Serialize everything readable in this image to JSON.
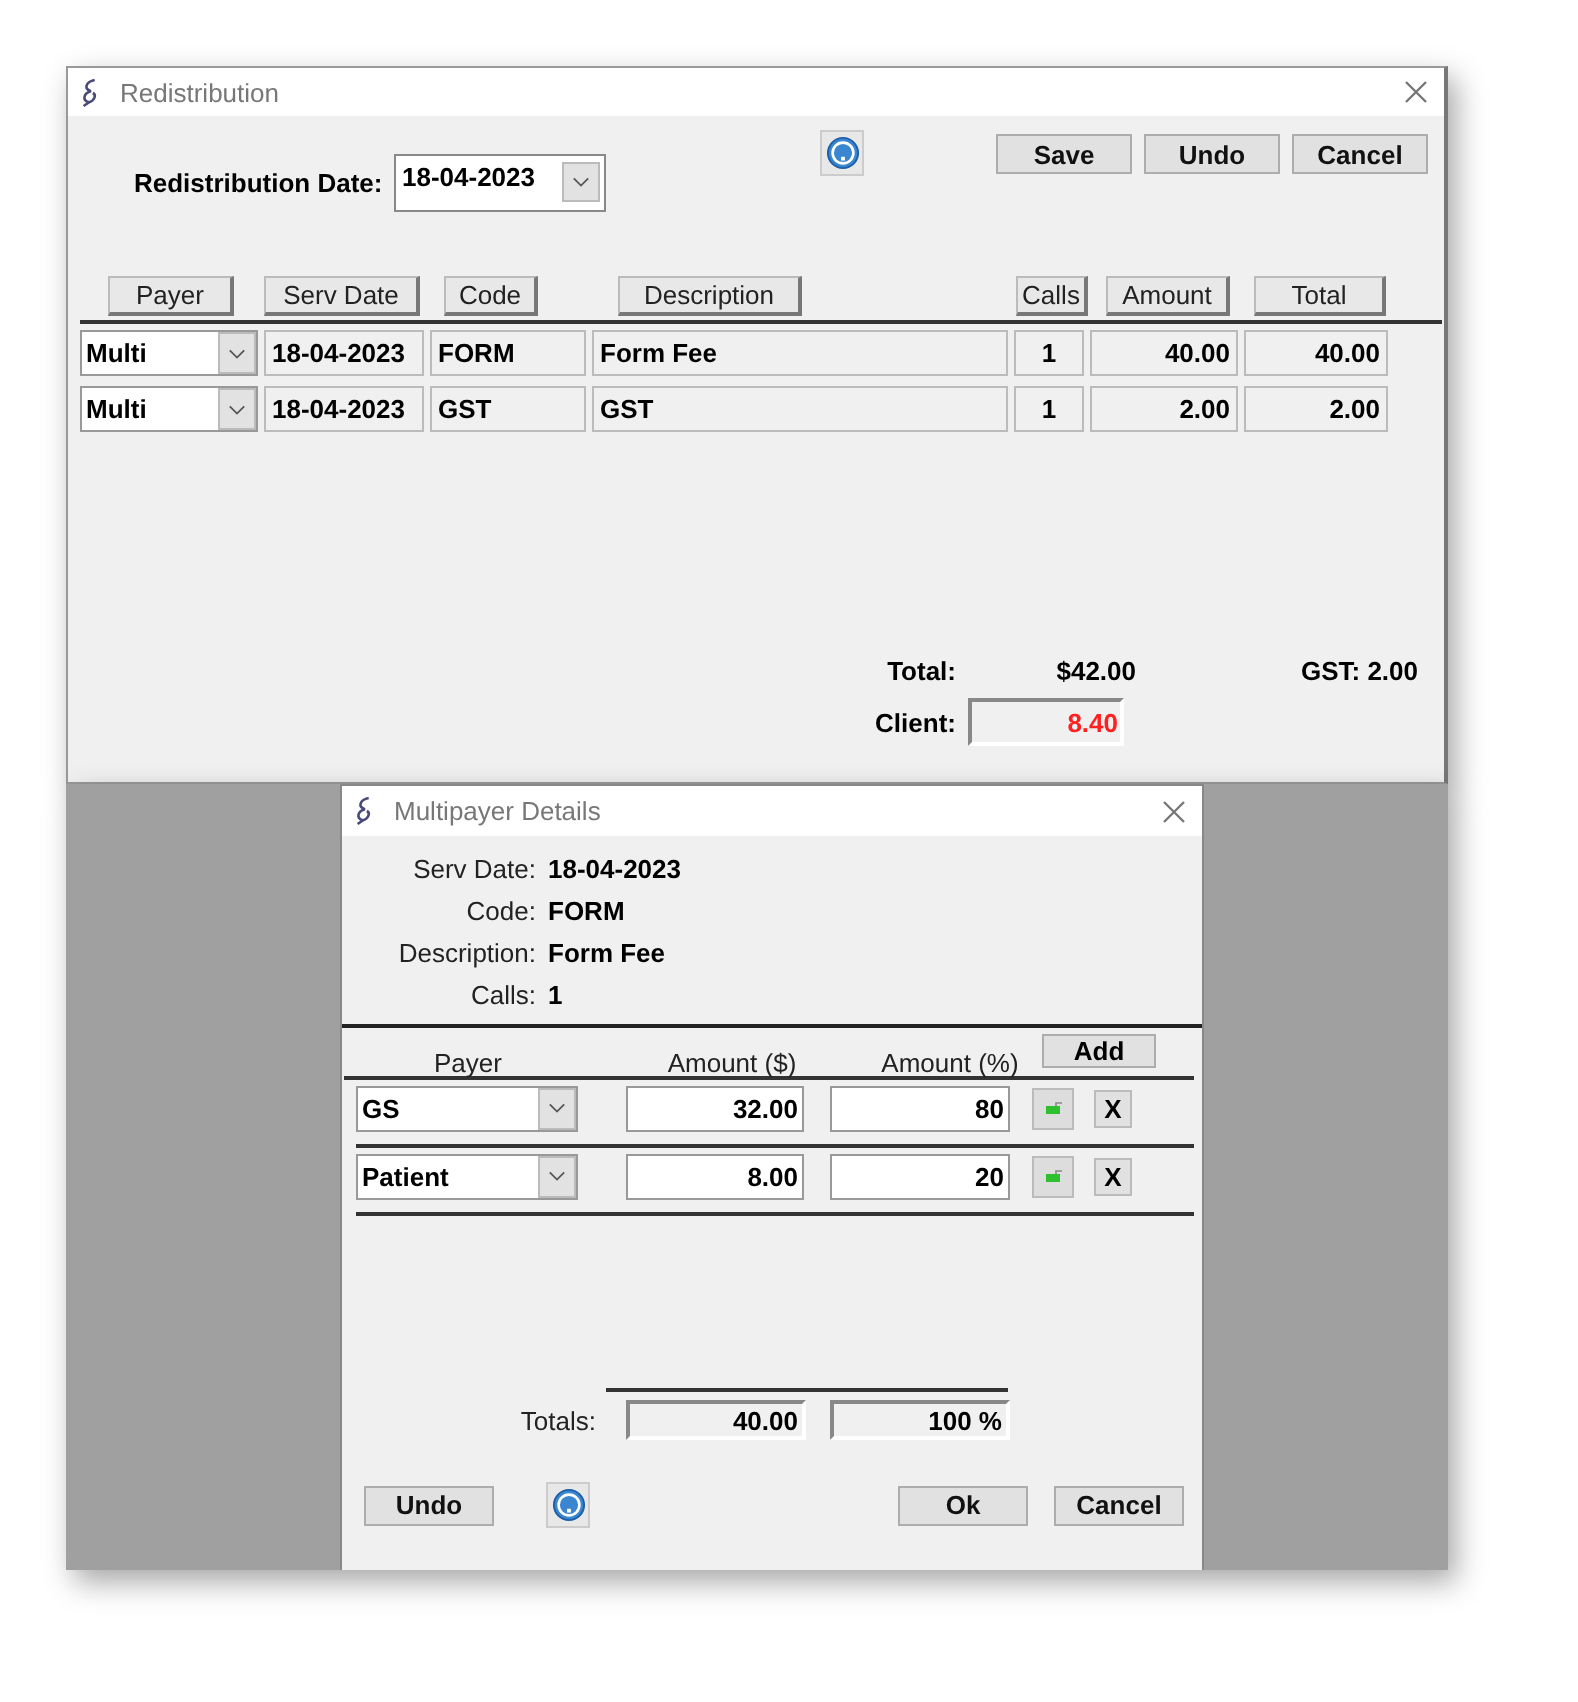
{
  "main_window": {
    "title": "Redistribution",
    "date_label": "Redistribution Date:",
    "date_value": "18-04-2023",
    "buttons": [
      "Save",
      "Undo",
      "Cancel"
    ],
    "columns": [
      "Payer",
      "Serv Date",
      "Code",
      "Description",
      "Calls",
      "Amount",
      "Total"
    ],
    "rows": [
      {
        "payer": "Multi",
        "serv_date": "18-04-2023",
        "code": "FORM",
        "description": "Form Fee",
        "calls": "1",
        "amount": "40.00",
        "total": "40.00"
      },
      {
        "payer": "Multi",
        "serv_date": "18-04-2023",
        "code": "GST",
        "description": "GST",
        "calls": "1",
        "amount": "2.00",
        "total": "2.00"
      }
    ],
    "total_label": "Total:",
    "total_value": "$42.00",
    "gst": "GST: 2.00",
    "client_label": "Client:",
    "client_value": "8.40"
  },
  "dialog": {
    "title": "Multipayer Details",
    "details": [
      {
        "label": "Serv Date:",
        "value": "18-04-2023"
      },
      {
        "label": "Code:",
        "value": "FORM"
      },
      {
        "label": "Description:",
        "value": "Form Fee"
      },
      {
        "label": "Calls:",
        "value": "1"
      }
    ],
    "columns": [
      "Payer",
      "Amount ($)",
      "Amount (%)"
    ],
    "add_button": "Add",
    "payers": [
      {
        "payer": "GS",
        "amount": "32.00",
        "percent": "80",
        "remove": "X"
      },
      {
        "payer": "Patient",
        "amount": "8.00",
        "percent": "20",
        "remove": "X"
      }
    ],
    "totals_label": "Totals:",
    "totals_amount": "40.00",
    "totals_percent": "100 %",
    "undo_button": "Undo",
    "ok_button": "Ok",
    "cancel_button": "Cancel"
  }
}
